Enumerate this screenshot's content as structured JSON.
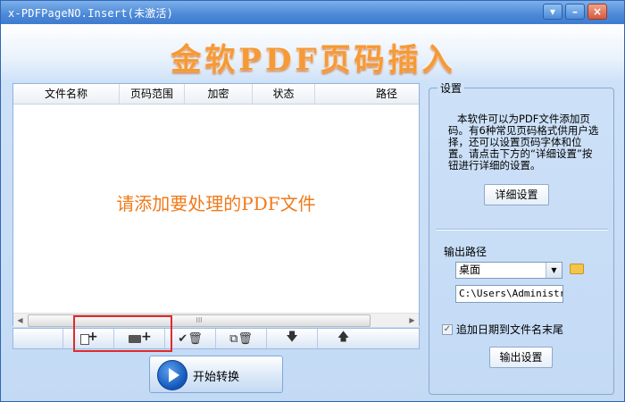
{
  "window": {
    "title": "x-PDFPageNO.Insert(未激活)",
    "controls": {
      "menu": "▾",
      "minimize": "–",
      "close": "×"
    }
  },
  "banner": {
    "title": "金软PDF页码插入"
  },
  "file_list": {
    "columns": [
      "文件名称",
      "页码范围",
      "加密",
      "状态",
      "路径"
    ],
    "placeholder": "请添加要处理的PDF文件",
    "scroll_grip": "III"
  },
  "toolbar": {
    "buttons": [
      {
        "name": "add-file",
        "icon": "add-file-icon"
      },
      {
        "name": "add-folder",
        "icon": "add-folder-icon"
      },
      {
        "name": "remove-selected",
        "icon": "check-delete-icon",
        "glyph": "✔🗑"
      },
      {
        "name": "remove-all",
        "icon": "copy-delete-icon",
        "glyph": "⧉🗑"
      },
      {
        "name": "move-down",
        "icon": "arrow-down-icon",
        "glyph": "🡇"
      },
      {
        "name": "move-up",
        "icon": "arrow-up-icon",
        "glyph": "🡅"
      }
    ],
    "highlight_color": "#e02b2b"
  },
  "start_button": {
    "label": "开始转换"
  },
  "settings": {
    "legend": "设置",
    "description": "本软件可以为PDF文件添加页码。有6种常见页码格式供用户选择，还可以设置页码字体和位置。请点击下方的“详细设置”按钮进行详细的设置。",
    "detail_button": "详细设置",
    "output_path_label": "输出路径",
    "output_select_value": "桌面",
    "output_path_value": "C:\\Users\\Administrator\\Desktop",
    "append_date_label": "追加日期到文件名末尾",
    "append_date_checked": true,
    "output_settings_button": "输出设置"
  },
  "colors": {
    "title_bar": "#4b88d6",
    "banner_text": "#f59a36",
    "placeholder_text": "#f07a1a",
    "panel_bg": "#cfe2f8"
  }
}
